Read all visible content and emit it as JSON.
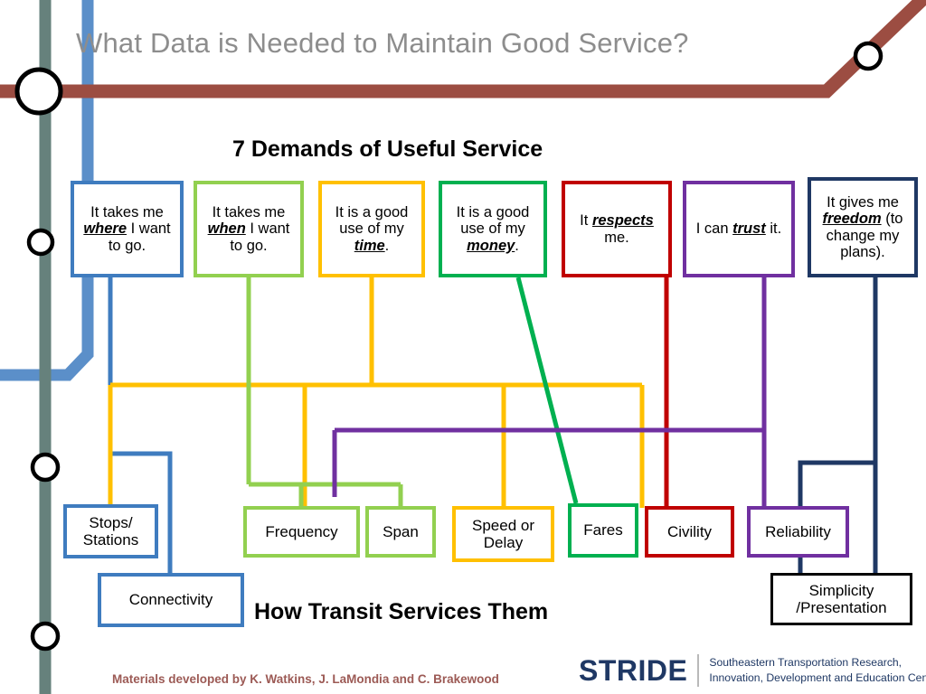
{
  "slide": {
    "title": "What Data is Needed to Maintain Good Service?",
    "demands_heading": "7 Demands of Useful Service",
    "how_heading": "How Transit Services Them"
  },
  "colors": {
    "title_gray": "#8d8d8d",
    "brown_line": "#9c4d42",
    "blue_line": "#5b8fc9",
    "green_gray_line": "#66817c",
    "blue": "#3f7cbf",
    "light_green": "#92d050",
    "yellow": "#ffc000",
    "green": "#00b050",
    "red": "#c00000",
    "purple": "#7030a0",
    "navy": "#1f3864",
    "black": "#000000",
    "credit_mauve": "#9c5a55",
    "stride_navy": "#1f3864"
  },
  "demands": [
    {
      "id": "where",
      "color": "#3f7cbf",
      "pre": "It takes me ",
      "key": "where",
      "post": " I want to go."
    },
    {
      "id": "when",
      "color": "#92d050",
      "pre": "It takes me ",
      "key": "when",
      "post": " I want to go."
    },
    {
      "id": "time",
      "color": "#ffc000",
      "pre": "It is a good use of my ",
      "key": "time",
      "post": "."
    },
    {
      "id": "money",
      "color": "#00b050",
      "pre": "It is a good use of my ",
      "key": "money",
      "post": "."
    },
    {
      "id": "respects",
      "color": "#c00000",
      "pre": "It ",
      "key": "respects",
      "post": " me."
    },
    {
      "id": "trust",
      "color": "#7030a0",
      "pre": "I can ",
      "key": "trust",
      "post": " it."
    },
    {
      "id": "freedom",
      "color": "#1f3864",
      "pre": "It gives me ",
      "key": "freedom",
      "post": " (to change my plans)."
    }
  ],
  "services": [
    {
      "id": "stops",
      "label": "Stops/ Stations",
      "color": "#3f7cbf"
    },
    {
      "id": "connectivity",
      "label": "Connectivity",
      "color": "#3f7cbf"
    },
    {
      "id": "frequency",
      "label": "Frequency",
      "color": "#92d050"
    },
    {
      "id": "span",
      "label": "Span",
      "color": "#92d050"
    },
    {
      "id": "speed",
      "label": "Speed or Delay",
      "color": "#ffc000"
    },
    {
      "id": "fares",
      "label": "Fares",
      "color": "#00b050"
    },
    {
      "id": "civility",
      "label": "Civility",
      "color": "#c00000"
    },
    {
      "id": "reliability",
      "label": "Reliability",
      "color": "#7030a0"
    },
    {
      "id": "simplicity",
      "label": "Simplicity /Presentation",
      "color": "#000000"
    }
  ],
  "footer": {
    "credit": "Materials developed by K. Watkins, J. LaMondia and C. Brakewood",
    "logo_wordmark": "STRIDE",
    "logo_tagline_line1": "Southeastern Transportation Research,",
    "logo_tagline_line2": "Innovation, Development and Education Center"
  }
}
